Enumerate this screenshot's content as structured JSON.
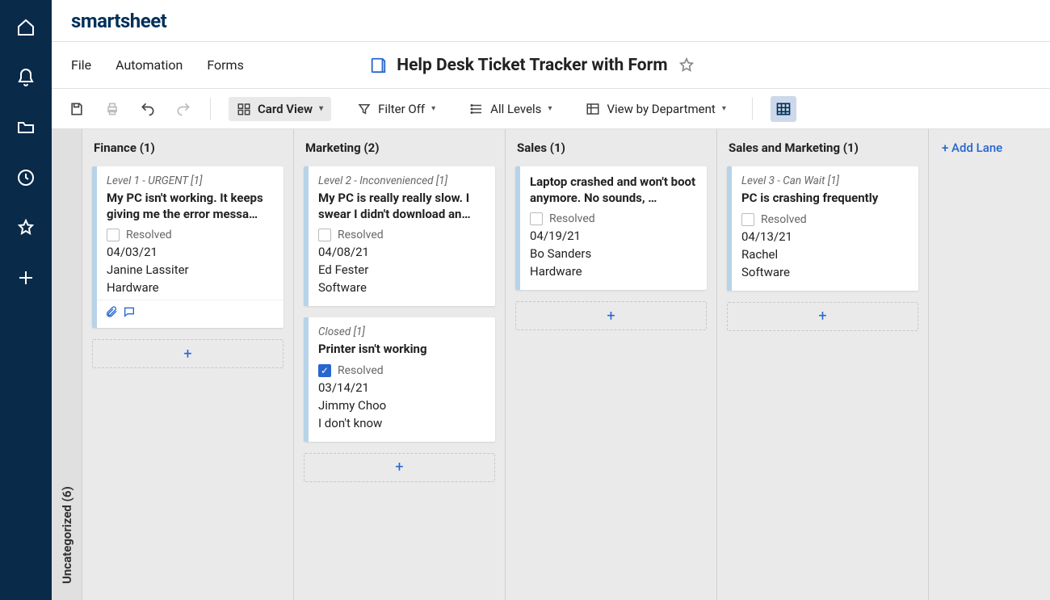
{
  "logo": "smartsheet",
  "menus": [
    "File",
    "Automation",
    "Forms"
  ],
  "page_title": "Help Desk Ticket Tracker with Form",
  "toolbar": {
    "card_view": "Card View",
    "filter": "Filter Off",
    "levels": "All Levels",
    "view_by": "View by Department"
  },
  "collapsed_lane": "Uncategorized (6)",
  "add_lane": "+ Add Lane",
  "resolved_label": "Resolved",
  "lanes": [
    {
      "title": "Finance (1)",
      "cards": [
        {
          "level": "Level 1 - URGENT [1]",
          "title": "My PC isn't working. It keeps giving me the error messa…",
          "resolved": false,
          "date": "04/03/21",
          "person": "Janine Lassiter",
          "category": "Hardware",
          "has_attach": true,
          "has_comment": true
        }
      ]
    },
    {
      "title": "Marketing (2)",
      "cards": [
        {
          "level": "Level 2 - Inconvenienced [1]",
          "title": "My PC is really really slow. I swear I didn't download an…",
          "resolved": false,
          "date": "04/08/21",
          "person": "Ed Fester",
          "category": "Software"
        },
        {
          "level": "Closed [1]",
          "title": "Printer isn't working",
          "resolved": true,
          "date": "03/14/21",
          "person": "Jimmy Choo",
          "category": "I don't know"
        }
      ]
    },
    {
      "title": "Sales (1)",
      "cards": [
        {
          "level": "",
          "title": "Laptop crashed and won't boot anymore. No sounds, …",
          "resolved": false,
          "date": "04/19/21",
          "person": "Bo Sanders",
          "category": "Hardware"
        }
      ]
    },
    {
      "title": "Sales and Marketing (1)",
      "cards": [
        {
          "level": "Level 3 - Can Wait [1]",
          "title": "PC is crashing frequently",
          "resolved": false,
          "date": "04/13/21",
          "person": "Rachel",
          "category": "Software"
        }
      ]
    }
  ]
}
